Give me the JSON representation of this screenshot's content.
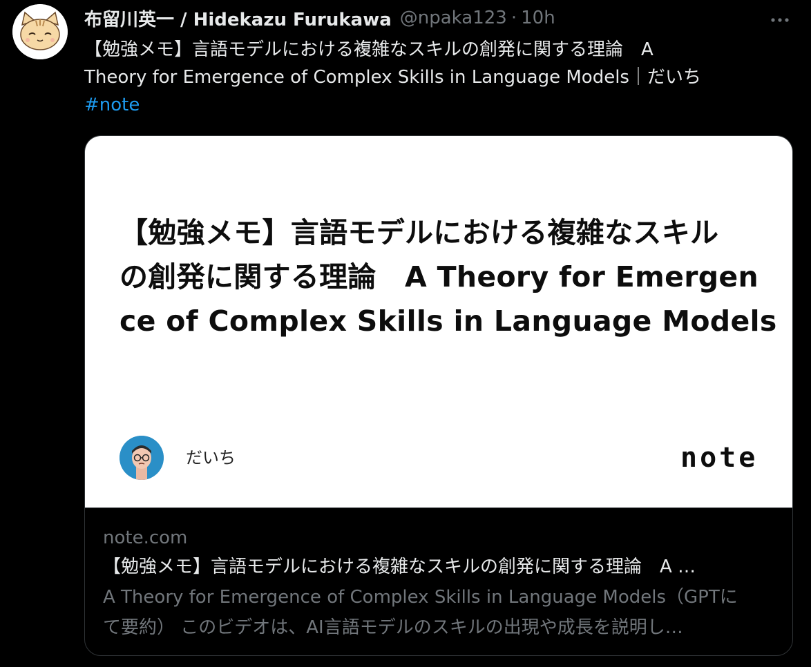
{
  "tweet": {
    "display_name": "布留川英一 / Hidekazu Furukawa",
    "handle": "@npaka123",
    "separator": "·",
    "time": "10h",
    "text_line_1": "【勉強メモ】言語モデルにおける複雑なスキルの創発に関する理論　A",
    "text_line_2": "Theory for Emergence of Complex Skills in Language Models｜だいち",
    "hashtag": "#note"
  },
  "card": {
    "image": {
      "title_line_1": "【勉強メモ】言語モデルにおける複雑なスキル",
      "title_line_2": "の創発に関する理論　A Theory for Emergen",
      "title_line_3": "ce of Complex Skills in Language Models",
      "author_name": "だいち",
      "logo_text": "note"
    },
    "domain": "note.com",
    "title": "【勉強メモ】言語モデルにおける複雑なスキルの創発に関する理論　A …",
    "description_line_1": "A Theory for Emergence of Complex Skills in Language Models（GPTに",
    "description_line_2": "て要約） このビデオは、AI言語モデルのスキルの出現や成長を説明し…"
  },
  "icons": {
    "avatar": "cat-face-icon",
    "more": "more-dots-icon",
    "author_avatar": "person-glasses-icon"
  },
  "colors": {
    "background": "#000000",
    "text_primary": "#e7e9ea",
    "text_secondary": "#71767b",
    "link": "#1d9bf0",
    "border": "#2f3336"
  }
}
